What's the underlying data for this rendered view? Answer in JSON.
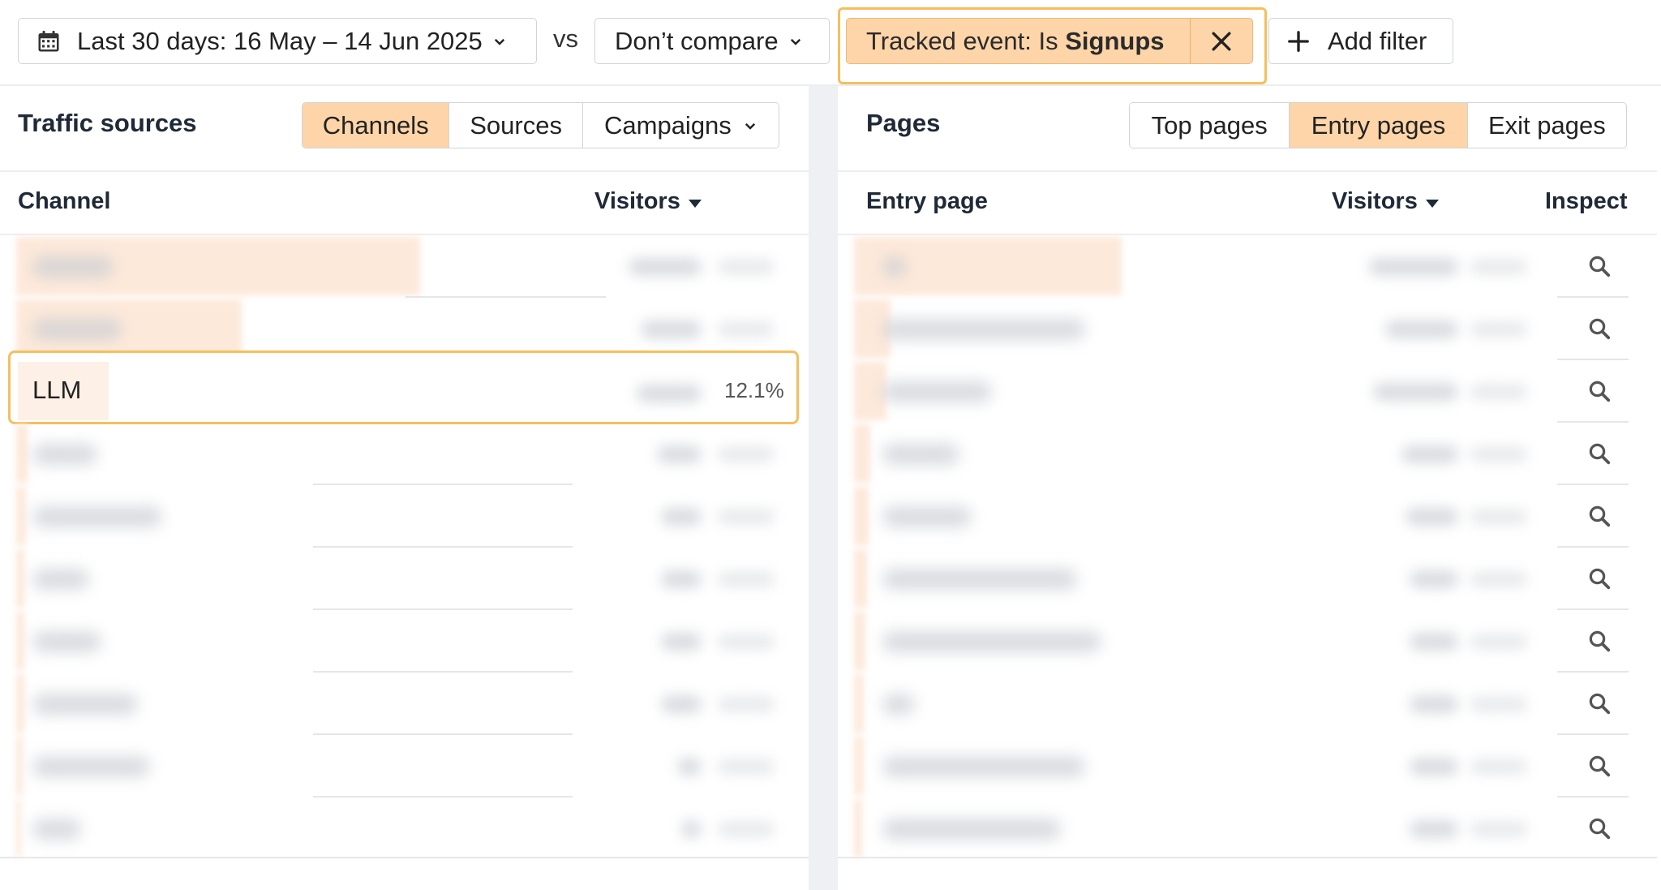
{
  "toolbar": {
    "date_range_label": "Last 30 days: 16 May – 14 Jun 2025",
    "vs_label": "vs",
    "compare_label": "Don’t compare",
    "filter_prefix": "Tracked event: Is ",
    "filter_value": "Signups",
    "add_filter_label": "Add filter"
  },
  "traffic_sources": {
    "title": "Traffic sources",
    "tabs": [
      {
        "label": "Channels",
        "active": true
      },
      {
        "label": "Sources",
        "active": false
      },
      {
        "label": "Campaigns",
        "active": false
      }
    ],
    "column_channel": "Channel",
    "column_visitors": "Visitors",
    "highlighted_row": {
      "channel": "LLM",
      "percent": "12.1%"
    }
  },
  "pages": {
    "title": "Pages",
    "tabs": [
      {
        "label": "Top pages",
        "active": false
      },
      {
        "label": "Entry pages",
        "active": true
      },
      {
        "label": "Exit pages",
        "active": false
      }
    ],
    "column_entry_page": "Entry page",
    "column_visitors": "Visitors",
    "column_inspect": "Inspect"
  },
  "colors": {
    "accent_fill": "#fdd5a8",
    "highlight_outline": "#f6bf5c",
    "bar_fill": "#fde9da"
  },
  "icons": [
    "calendar-icon",
    "chevron-down-icon",
    "close-icon",
    "plus-icon",
    "caret-down-icon",
    "search-icon"
  ]
}
